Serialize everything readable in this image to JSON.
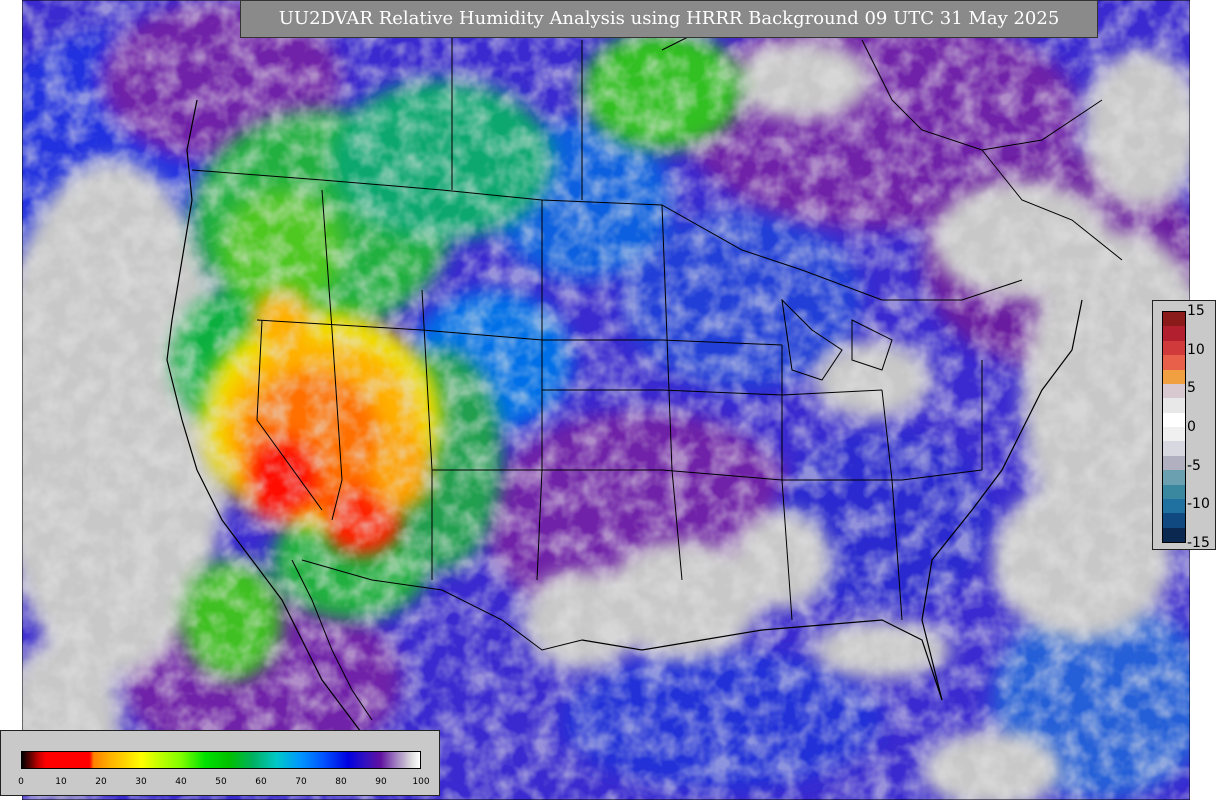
{
  "title": "UU2DVAR Relative Humidity Analysis using HRRR Background 09 UTC 31 May 2025",
  "rh_legend": {
    "ticks": [
      "0",
      "10",
      "20",
      "30",
      "40",
      "50",
      "60",
      "70",
      "80",
      "90",
      "100"
    ],
    "min": 0,
    "max": 100
  },
  "increment_legend": {
    "ticks": [
      "15",
      "10",
      "5",
      "0",
      "-5",
      "-10",
      "-15"
    ],
    "colors": [
      "#8b1a1a",
      "#b22030",
      "#d03a3a",
      "#e8604a",
      "#f0a040",
      "#d8c8d0",
      "#e8e8e8",
      "#ffffff",
      "#f0f0f0",
      "#d8d8e0",
      "#b0b0c0",
      "#6aa0b0",
      "#3a88a0",
      "#2070a0",
      "#104880",
      "#0a2850"
    ]
  },
  "colors": {
    "ocean_gray": "#c8c8c8",
    "dry_red": "#ff0000",
    "moist_blue": "#0000e0",
    "humid_purple": "#7010a0",
    "title_box": "#8a8a8a"
  }
}
